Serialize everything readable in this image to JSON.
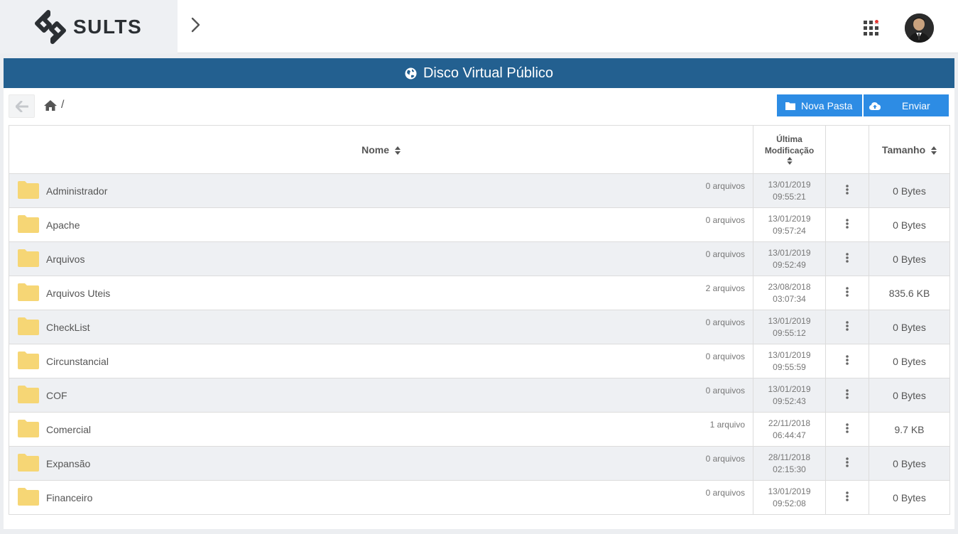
{
  "brand": {
    "name": "SULTS"
  },
  "header": {
    "title": "Disco Virtual Público",
    "icon": "globe-icon"
  },
  "breadcrumb": {
    "separator": "/"
  },
  "buttons": {
    "new_folder": "Nova Pasta",
    "upload": "Enviar"
  },
  "columns": {
    "name": "Nome",
    "modified_line1": "Última",
    "modified_line2": "Modificação",
    "size": "Tamanho"
  },
  "rows": [
    {
      "name": "Administrador",
      "count": "0 arquivos",
      "date": "13/01/2019",
      "time": "09:55:21",
      "size": "0 Bytes"
    },
    {
      "name": "Apache",
      "count": "0 arquivos",
      "date": "13/01/2019",
      "time": "09:57:24",
      "size": "0 Bytes"
    },
    {
      "name": "Arquivos",
      "count": "0 arquivos",
      "date": "13/01/2019",
      "time": "09:52:49",
      "size": "0 Bytes"
    },
    {
      "name": "Arquivos Uteis",
      "count": "2 arquivos",
      "date": "23/08/2018",
      "time": "03:07:34",
      "size": "835.6 KB"
    },
    {
      "name": "CheckList",
      "count": "0 arquivos",
      "date": "13/01/2019",
      "time": "09:55:12",
      "size": "0 Bytes"
    },
    {
      "name": "Circunstancial",
      "count": "0 arquivos",
      "date": "13/01/2019",
      "time": "09:55:59",
      "size": "0 Bytes"
    },
    {
      "name": "COF",
      "count": "0 arquivos",
      "date": "13/01/2019",
      "time": "09:52:43",
      "size": "0 Bytes"
    },
    {
      "name": "Comercial",
      "count": "1 arquivo",
      "date": "22/11/2018",
      "time": "06:44:47",
      "size": "9.7 KB"
    },
    {
      "name": "Expansão",
      "count": "0 arquivos",
      "date": "28/11/2018",
      "time": "02:15:30",
      "size": "0 Bytes"
    },
    {
      "name": "Financeiro",
      "count": "0 arquivos",
      "date": "13/01/2019",
      "time": "09:52:08",
      "size": "0 Bytes"
    }
  ],
  "colors": {
    "header_bg": "#236090",
    "button_bg": "#2d8ce4",
    "folder": "#f6d675",
    "alt_row": "#eef0f3",
    "notification": "#e53935"
  }
}
